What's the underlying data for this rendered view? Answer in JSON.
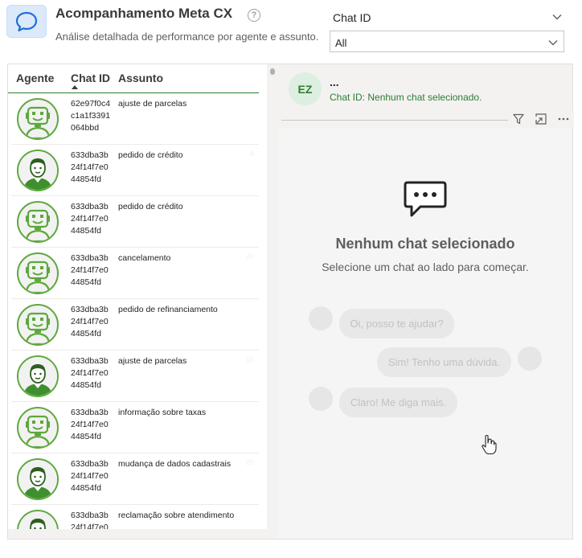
{
  "header": {
    "title": "Acompanhamento Meta CX",
    "subtitle": "Análise detalhada de performance por agente e assunto.",
    "help_glyph": "?"
  },
  "filter": {
    "label": "Chat ID",
    "selected": "All"
  },
  "table": {
    "columns": [
      "Agente",
      "Chat ID",
      "Assunto"
    ],
    "sort_column": "Chat ID",
    "sort_direction": "ascending",
    "rows": [
      {
        "avatar": "robot",
        "chat_id": "62e97f0c4c1a1f3391064bbd",
        "chat_id_lines": [
          "62e97f0c4",
          "c1a1f3391",
          "064bbd"
        ],
        "subject": "ajuste de parcelas",
        "ghost": ""
      },
      {
        "avatar": "person",
        "chat_id": "633dba3b24f14f7e044854fd",
        "chat_id_lines": [
          "633dba3b",
          "24f14f7e0",
          "44854fd"
        ],
        "subject": "pedido de crédito",
        "ghost": "8"
      },
      {
        "avatar": "robot",
        "chat_id": "633dba3b24f14f7e044854fd",
        "chat_id_lines": [
          "633dba3b",
          "24f14f7e0",
          "44854fd"
        ],
        "subject": "pedido de crédito",
        "ghost": ""
      },
      {
        "avatar": "robot",
        "chat_id": "633dba3b24f14f7e044854fd",
        "chat_id_lines": [
          "633dba3b",
          "24f14f7e0",
          "44854fd"
        ],
        "subject": "cancelamento",
        "ghost": "20"
      },
      {
        "avatar": "robot",
        "chat_id": "633dba3b24f14f7e044854fd",
        "chat_id_lines": [
          "633dba3b",
          "24f14f7e0",
          "44854fd"
        ],
        "subject": "pedido de refinanciamento",
        "ghost": ""
      },
      {
        "avatar": "person",
        "chat_id": "633dba3b24f14f7e044854fd",
        "chat_id_lines": [
          "633dba3b",
          "24f14f7e0",
          "44854fd"
        ],
        "subject": "ajuste de parcelas",
        "ghost": "16"
      },
      {
        "avatar": "robot",
        "chat_id": "633dba3b24f14f7e044854fd",
        "chat_id_lines": [
          "633dba3b",
          "24f14f7e0",
          "44854fd"
        ],
        "subject": "informação sobre taxas",
        "ghost": ""
      },
      {
        "avatar": "person",
        "chat_id": "633dba3b24f14f7e044854fd",
        "chat_id_lines": [
          "633dba3b",
          "24f14f7e0",
          "44854fd"
        ],
        "subject": "mudança de dados cadastrais",
        "ghost": "20"
      },
      {
        "avatar": "person",
        "chat_id": "633dba3b24f14f7e0",
        "chat_id_lines": [
          "633dba3b",
          "24f14f7e0"
        ],
        "subject": "reclamação sobre atendimento",
        "ghost": ""
      }
    ]
  },
  "detail": {
    "badge": "EZ",
    "name": "...",
    "chat_id_text": "Chat ID: Nenhum chat selecionado.",
    "empty_title": "Nenhum chat selecionado",
    "empty_subtitle": "Selecione um chat ao lado para começar.",
    "preview_messages": [
      {
        "side": "left",
        "text": "Oi, posso te ajudar?"
      },
      {
        "side": "right",
        "text": "Sim! Tenho uma dúvida."
      },
      {
        "side": "left",
        "text": "Claro! Me diga mais."
      }
    ]
  },
  "icons": {
    "app": "chat-bubble-icon",
    "help": "help-icon",
    "filter_toggle": "chevron-down-icon",
    "visual_filter": "filter-icon",
    "focus_mode": "focus-mode-icon",
    "more_options": "more-options-icon"
  },
  "colors": {
    "accent_green": "#2e7d32",
    "avatar_ring": "#5da83c",
    "app_icon_blue": "#1e6fd9"
  }
}
